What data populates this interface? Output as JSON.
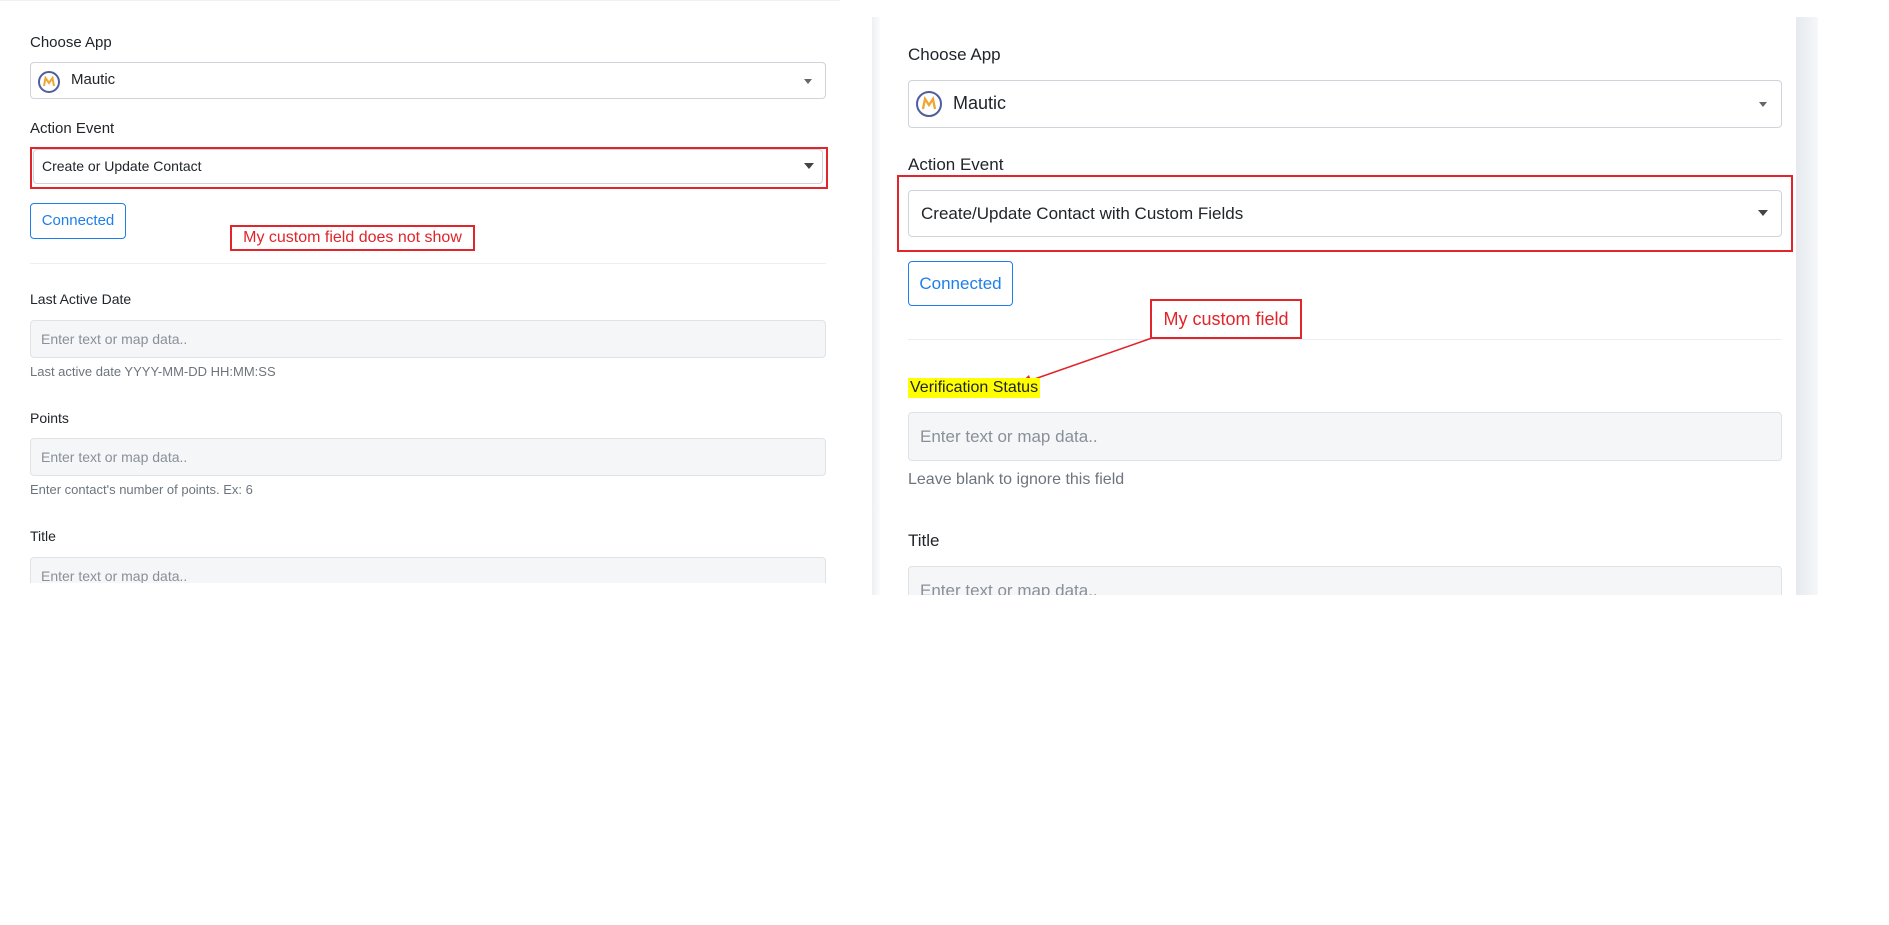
{
  "left": {
    "choose_app_label": "Choose App",
    "app_value": "Mautic",
    "action_event_label": "Action Event",
    "action_event_value": "Create or Update Contact",
    "connected_label": "Connected",
    "annotation": "My custom field does not show",
    "fields": [
      {
        "label": "Last Active Date",
        "placeholder": "Enter text or map data..",
        "help": "Last active date YYYY-MM-DD HH:MM:SS"
      },
      {
        "label": "Points",
        "placeholder": "Enter text or map data..",
        "help": "Enter contact's number of points. Ex: 6"
      },
      {
        "label": "Title",
        "placeholder": "Enter text or map data.."
      }
    ]
  },
  "right": {
    "choose_app_label": "Choose App",
    "app_value": "Mautic",
    "action_event_label": "Action Event",
    "action_event_value": "Create/Update Contact with Custom Fields",
    "connected_label": "Connected",
    "annotation": "My custom field",
    "fields": [
      {
        "label": "Verification Status",
        "placeholder": "Enter text or map data..",
        "help": "Leave blank to ignore this field"
      },
      {
        "label": "Title",
        "placeholder": "Enter text or map data.."
      }
    ]
  },
  "colors": {
    "annotation_red": "#e0252b",
    "connected_blue": "#1f7fea",
    "highlight_yellow": "#ffff00",
    "mautic_orange": "#f0a630",
    "mautic_navy": "#4e5e9e"
  },
  "icons": {
    "app_logo": "mautic-logo-icon",
    "select_caret": "caret-down-icon",
    "annotation_arrow": "arrow-icon"
  }
}
